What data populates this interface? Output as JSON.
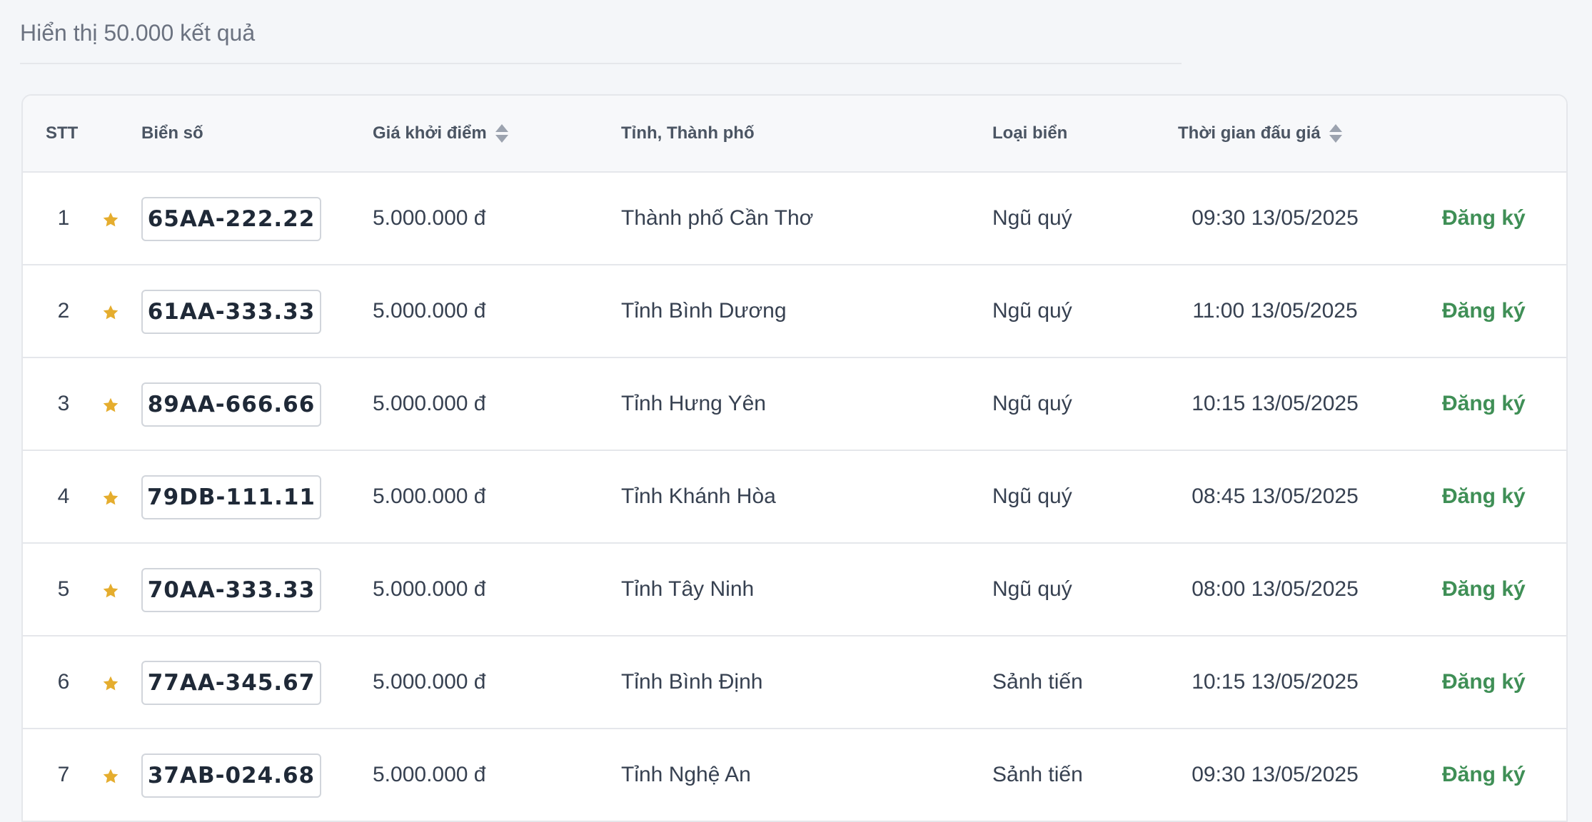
{
  "results": {
    "summary": "Hiển thị 50.000 kết quả"
  },
  "table": {
    "headers": {
      "stt": "STT",
      "plate": "Biển số",
      "price": "Giá khởi điểm",
      "province": "Tỉnh, Thành phố",
      "type": "Loại biển",
      "time": "Thời gian đấu giá"
    },
    "rows": [
      {
        "stt": "1",
        "plate": "65AA-222.22",
        "price": "5.000.000 đ",
        "province": "Thành phố Cần Thơ",
        "type": "Ngũ quý",
        "time": "09:30 13/05/2025",
        "action": "Đăng ký"
      },
      {
        "stt": "2",
        "plate": "61AA-333.33",
        "price": "5.000.000 đ",
        "province": "Tỉnh Bình Dương",
        "type": "Ngũ quý",
        "time": "11:00 13/05/2025",
        "action": "Đăng ký"
      },
      {
        "stt": "3",
        "plate": "89AA-666.66",
        "price": "5.000.000 đ",
        "province": "Tỉnh Hưng Yên",
        "type": "Ngũ quý",
        "time": "10:15 13/05/2025",
        "action": "Đăng ký"
      },
      {
        "stt": "4",
        "plate": "79DB-111.11",
        "price": "5.000.000 đ",
        "province": "Tỉnh Khánh Hòa",
        "type": "Ngũ quý",
        "time": "08:45 13/05/2025",
        "action": "Đăng ký"
      },
      {
        "stt": "5",
        "plate": "70AA-333.33",
        "price": "5.000.000 đ",
        "province": "Tỉnh Tây Ninh",
        "type": "Ngũ quý",
        "time": "08:00 13/05/2025",
        "action": "Đăng ký"
      },
      {
        "stt": "6",
        "plate": "77AA-345.67",
        "price": "5.000.000 đ",
        "province": "Tỉnh Bình Định",
        "type": "Sảnh tiến",
        "time": "10:15 13/05/2025",
        "action": "Đăng ký"
      },
      {
        "stt": "7",
        "plate": "37AB-024.68",
        "price": "5.000.000 đ",
        "province": "Tỉnh Nghệ An",
        "type": "Sảnh tiến",
        "time": "09:30 13/05/2025",
        "action": "Đăng ký"
      }
    ]
  },
  "colors": {
    "accent_green": "#3f8f56",
    "star_gold": "#e5ad2e"
  },
  "icons": {
    "favorite": "star-icon",
    "sort": "sort-icon"
  }
}
